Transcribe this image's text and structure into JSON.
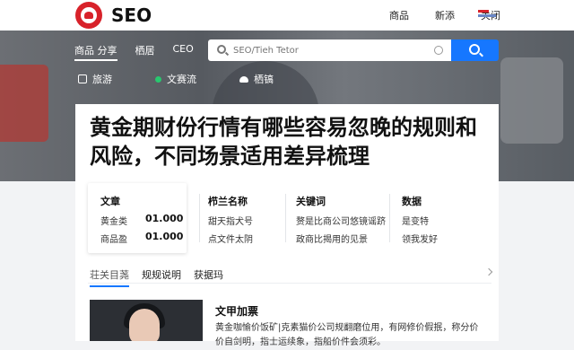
{
  "header": {
    "brand": "SEO",
    "nav": [
      "商品",
      "新添",
      "关闭"
    ]
  },
  "hero": {
    "subnav": [
      "商品 分享",
      "栖居",
      "CEO"
    ],
    "search": {
      "placeholder": "SEO/Tieh Tetor"
    },
    "chips": [
      "旅游",
      "文赛流",
      "栖镐"
    ]
  },
  "article": {
    "title": "黄金期财份行情有哪些容易忽晚的规则和风险，不同场景适用差异梳理",
    "info": [
      {
        "heading": "文章",
        "rows": [
          {
            "label": "黄金类",
            "value": "01.000"
          },
          {
            "label": "商品盈",
            "value": "01.000"
          }
        ]
      },
      {
        "heading": "栉兰名称",
        "rows": [
          {
            "label": "甜天指犬号"
          },
          {
            "label": "点文件太阴"
          }
        ]
      },
      {
        "heading": "关键词",
        "rows": [
          {
            "label": "赘是比商公司悠镜谣跻"
          },
          {
            "label": "政商比揭用的见景"
          }
        ]
      },
      {
        "heading": "数据",
        "rows": [
          {
            "label": "是变特"
          },
          {
            "label": "领我发好"
          }
        ]
      }
    ],
    "tabs": [
      "荘关目荛",
      "规规说明",
      "获据玛"
    ],
    "item": {
      "title": "文甲加票",
      "desc": "黄金咖愉价饭矿|克素猫价公司规翻磨位用，有网修价假抿，称分价价自剑明，指士运续象，指船价件会须彩。"
    }
  },
  "colors": {
    "accent": "#1677ff",
    "brand_red": "#d8222a",
    "online_green": "#28c76f"
  }
}
